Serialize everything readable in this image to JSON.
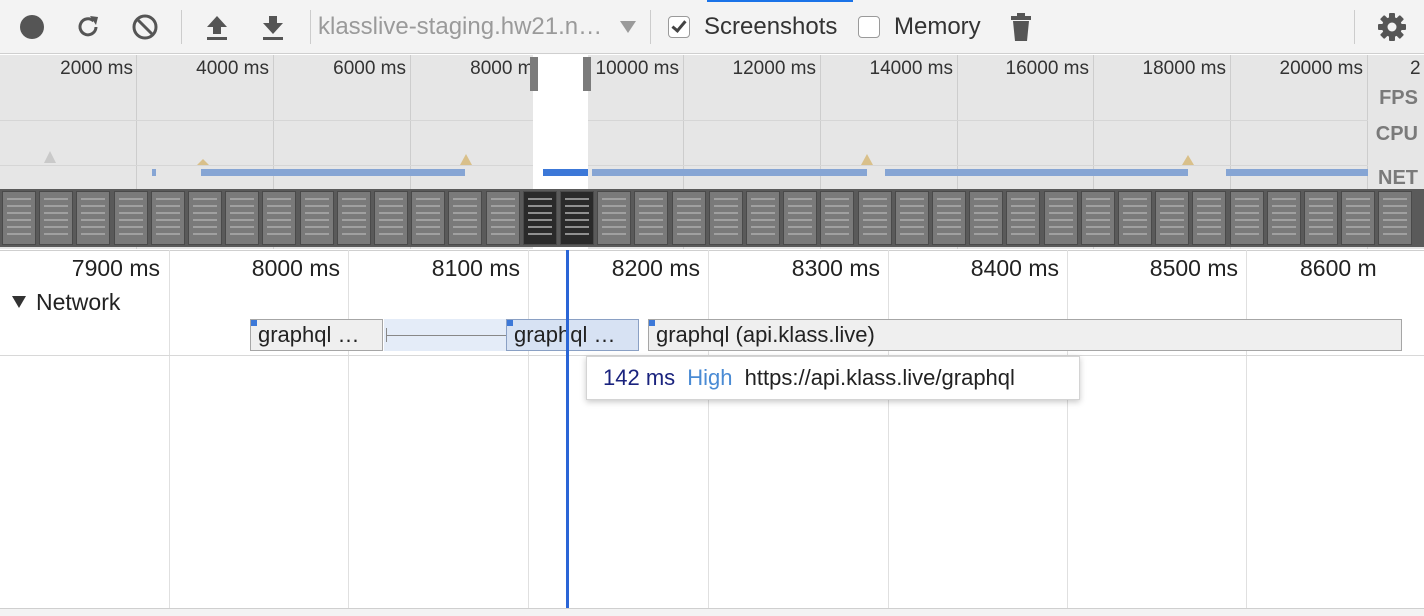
{
  "toolbar": {
    "record_icon": "record-icon",
    "reload_icon": "reload-icon",
    "clear_icon": "clear-icon",
    "upload_icon": "upload-icon",
    "download_icon": "download-icon",
    "url_select_value": "klasslive-staging.hw21.n…",
    "screenshots_label": "Screenshots",
    "screenshots_checked": true,
    "memory_label": "Memory",
    "memory_checked": false,
    "gc_icon": "trash-icon",
    "settings_icon": "gear-icon",
    "accent_color": "#1a73e8"
  },
  "overview": {
    "ticks": [
      "2000 ms",
      "4000 ms",
      "6000 ms",
      "8000 ms",
      "10000 ms",
      "12000 ms",
      "14000 ms",
      "16000 ms",
      "18000 ms",
      "20000 ms",
      "2"
    ],
    "lanes": {
      "fps": "FPS",
      "cpu": "CPU",
      "net": "NET"
    },
    "net_color": "#86a5d4"
  },
  "ruler": {
    "ticks": [
      "7900 ms",
      "8000 ms",
      "8100 ms",
      "8200 ms",
      "8300 ms",
      "8400 ms",
      "8500 ms",
      "8600 m"
    ]
  },
  "network": {
    "header": "Network",
    "requests": [
      {
        "label": "graphql …"
      },
      {
        "label": "graphql …"
      },
      {
        "label": "graphql (api.klass.live)"
      }
    ]
  },
  "tooltip": {
    "duration": "142 ms",
    "priority": "High",
    "url": "https://api.klass.live/graphql"
  },
  "colors": {
    "cursor": "#2a65d6",
    "tooltip_duration": "#1a237e",
    "tooltip_priority": "#4a8bd4"
  }
}
